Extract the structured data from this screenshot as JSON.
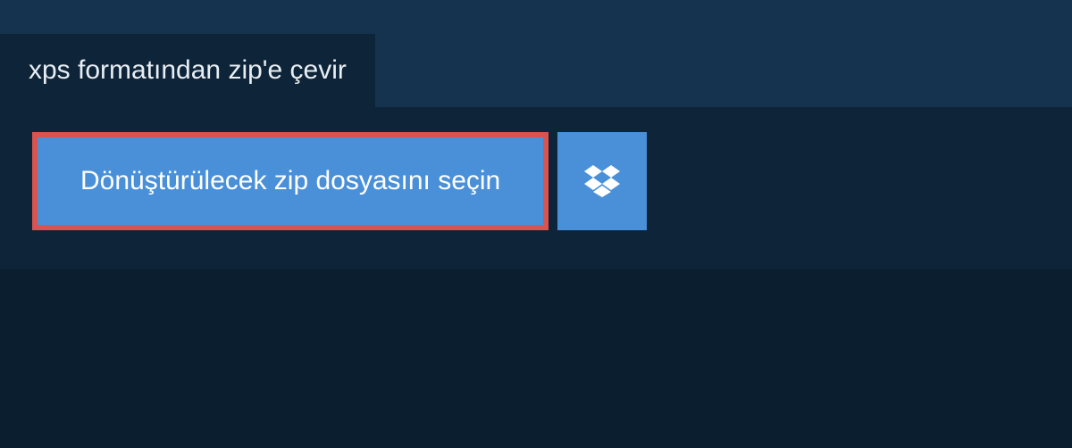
{
  "tab": {
    "title": "xps formatından zip'e çevir"
  },
  "actions": {
    "select_file_label": "Dönüştürülecek zip dosyasını seçin"
  },
  "colors": {
    "background": "#15324e",
    "panel": "#0e2439",
    "button": "#4a90d9",
    "highlight_border": "#d9534f",
    "bottom": "#0b1e30"
  }
}
